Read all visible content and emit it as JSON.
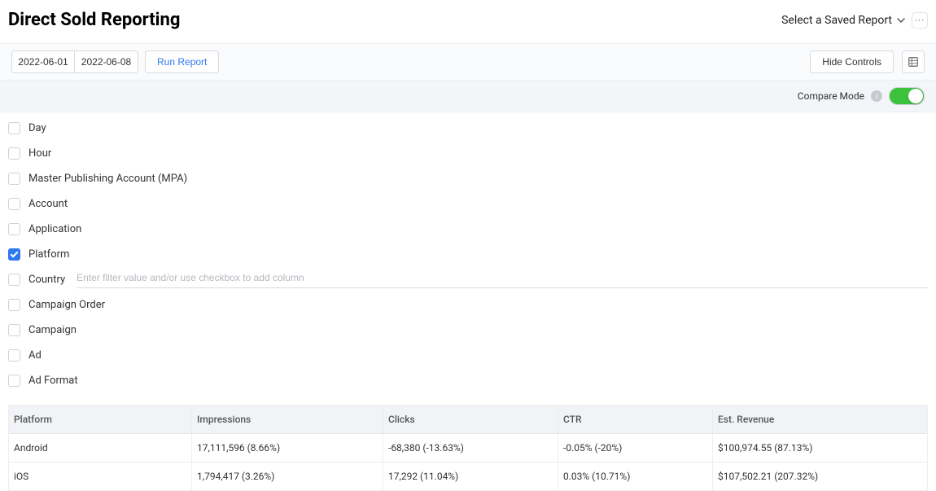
{
  "header": {
    "title": "Direct Sold Reporting",
    "select_report": "Select a Saved Report"
  },
  "controls": {
    "date_start": "2022-06-01",
    "date_end": "2022-06-08",
    "run_label": "Run Report",
    "hide_controls_label": "Hide Controls"
  },
  "compare": {
    "label": "Compare Mode",
    "enabled": true
  },
  "filters": [
    {
      "key": "day",
      "label": "Day",
      "checked": false
    },
    {
      "key": "hour",
      "label": "Hour",
      "checked": false
    },
    {
      "key": "mpa",
      "label": "Master Publishing Account (MPA)",
      "checked": false
    },
    {
      "key": "account",
      "label": "Account",
      "checked": false
    },
    {
      "key": "application",
      "label": "Application",
      "checked": false
    },
    {
      "key": "platform",
      "label": "Platform",
      "checked": true
    },
    {
      "key": "country",
      "label": "Country",
      "checked": false,
      "has_input": true,
      "placeholder": "Enter filter value and/or use checkbox to add column"
    },
    {
      "key": "campaign_order",
      "label": "Campaign Order",
      "checked": false
    },
    {
      "key": "campaign",
      "label": "Campaign",
      "checked": false
    },
    {
      "key": "ad",
      "label": "Ad",
      "checked": false
    },
    {
      "key": "ad_format",
      "label": "Ad Format",
      "checked": false
    }
  ],
  "table": {
    "columns": [
      "Platform",
      "Impressions",
      "Clicks",
      "CTR",
      "Est. Revenue"
    ],
    "rows": [
      {
        "platform": "Android",
        "impressions": "17,111,596 (8.66%)",
        "clicks": "-68,380 (-13.63%)",
        "ctr": "-0.05% (-20%)",
        "revenue": "$100,974.55 (87.13%)"
      },
      {
        "platform": "iOS",
        "impressions": "1,794,417 (3.26%)",
        "clicks": "17,292 (11.04%)",
        "ctr": "0.03% (10.71%)",
        "revenue": "$107,502.21 (207.32%)"
      }
    ]
  }
}
